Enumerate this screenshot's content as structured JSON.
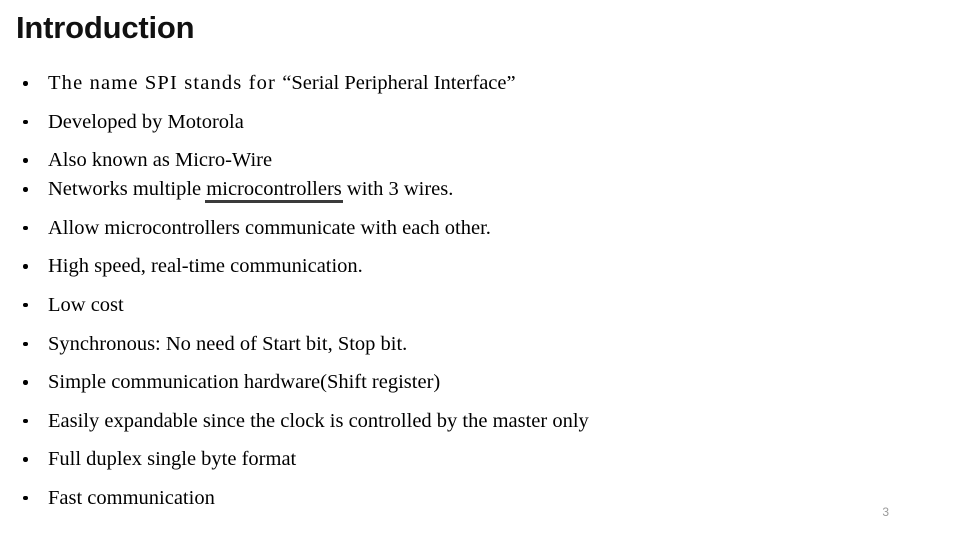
{
  "slide": {
    "title": "Introduction",
    "page_number": "3",
    "background_color": "#ffffff",
    "text_color": "#000000",
    "title_color": "#111111",
    "page_number_color": "#9a9a9a",
    "underline_color": "#3b3b3b",
    "bullets": [
      {
        "id": "bullet-spi-name",
        "pre": "The name SPI stands for ",
        "emphasis_quote": "“Serial Peripheral Interface”",
        "post": "",
        "full_text": "The name SPI stands for “Serial Peripheral Interface”",
        "style": "wide-letter-spacing"
      },
      {
        "id": "bullet-developed-by",
        "full_text": "Developed by Motorola",
        "style": "normal"
      },
      {
        "id": "bullet-micro-wire",
        "full_text": "Also known as Micro-Wire",
        "style": "normal"
      },
      {
        "id": "bullet-networks-multiple",
        "pre": "Networks multiple ",
        "underlined": "microcontrollers",
        "post": " with 3 wires.",
        "full_text": "Networks multiple microcontrollers with 3 wires.",
        "style": "has-heavy-underline"
      },
      {
        "id": "bullet-allow-communicate",
        "full_text": "Allow microcontrollers communicate with each other.",
        "style": "normal"
      },
      {
        "id": "bullet-high-speed",
        "full_text": "High speed, real-time communication.",
        "style": "normal"
      },
      {
        "id": "bullet-low-cost",
        "full_text": "Low cost",
        "style": "normal"
      },
      {
        "id": "bullet-synchronous",
        "full_text": "Synchronous: No need of Start bit, Stop bit.",
        "style": "normal"
      },
      {
        "id": "bullet-simple-hardware",
        "full_text": "Simple communication hardware(Shift register)",
        "style": "normal"
      },
      {
        "id": "bullet-easily-expandable",
        "full_text": "Easily expandable since the clock is controlled by the master only",
        "style": "normal"
      },
      {
        "id": "bullet-full-duplex",
        "full_text": "Full duplex single byte format",
        "style": "normal"
      },
      {
        "id": "bullet-fast-communication",
        "full_text": "Fast communication",
        "style": "normal"
      }
    ]
  }
}
